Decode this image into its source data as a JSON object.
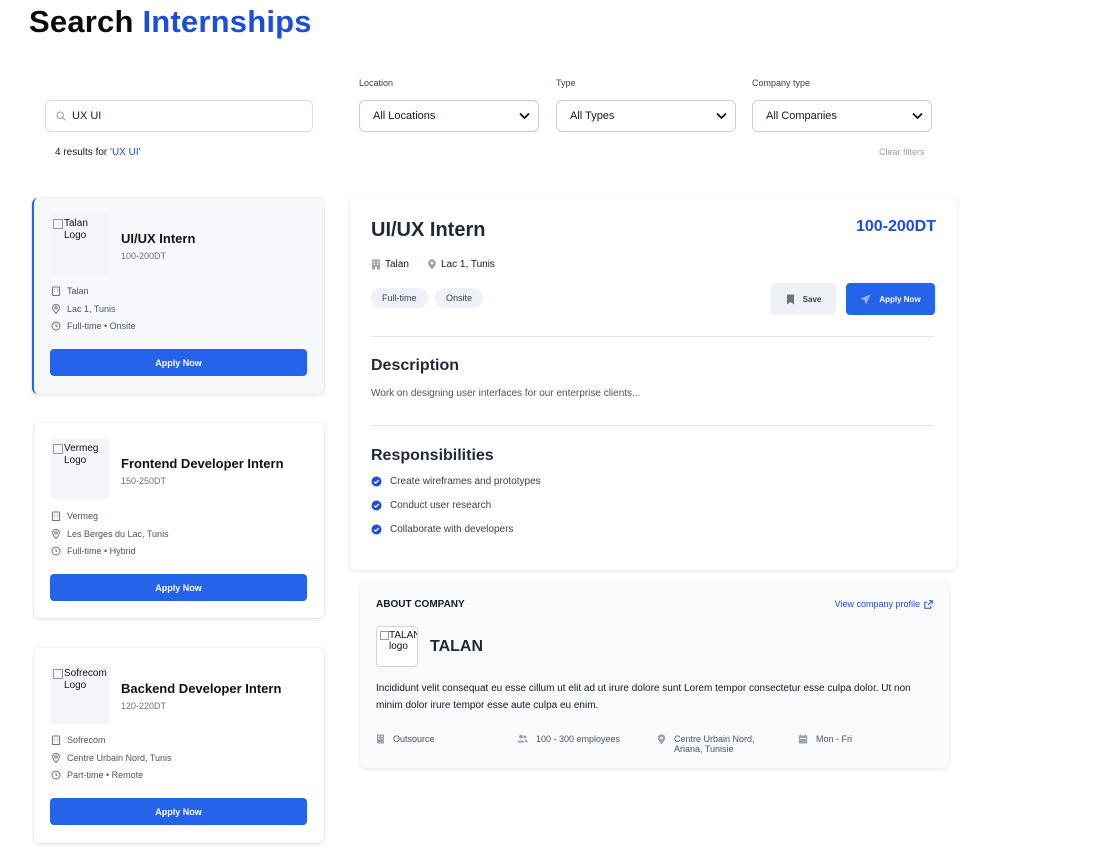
{
  "header": {
    "title_prefix": "Search",
    "title_accent": "Internships"
  },
  "filters": {
    "search_value": "UX UI",
    "location": {
      "label": "Location",
      "selected": "All Locations"
    },
    "type": {
      "label": "Type",
      "selected": "All Types"
    },
    "company_type": {
      "label": "Company type",
      "selected": "All Companies"
    },
    "results_text": "4 results for ",
    "results_query": "'UX UI'",
    "clear_label": "Clear filters"
  },
  "cards": [
    {
      "logo_alt": "Talan Logo",
      "title": "UI/UX Intern",
      "salary": "100-200DT",
      "company": "Talan",
      "location": "Lac 1, Tunis",
      "schedule": "Full-time • Onsite",
      "apply_label": "Apply Now"
    },
    {
      "logo_alt": "Vermeg Logo",
      "title": "Frontend Developer Intern",
      "salary": "150-250DT",
      "company": "Vermeg",
      "location": "Les Berges du Lac, Tunis",
      "schedule": "Full-time • Hybrid",
      "apply_label": "Apply Now"
    },
    {
      "logo_alt": "Sofrecom Logo",
      "title": "Backend Developer Intern",
      "salary": "120-220DT",
      "company": "Sofrecom",
      "location": "Centre Urbain Nord, Tunis",
      "schedule": "Part-time • Remote",
      "apply_label": "Apply Now"
    }
  ],
  "detail": {
    "title": "UI/UX Intern",
    "salary": "100-200DT",
    "company": "Talan",
    "location": "Lac 1, Tunis",
    "tags": [
      "Full-time",
      "Onsite"
    ],
    "save_label": "Save",
    "apply_label": "Apply Now",
    "description_title": "Description",
    "description": "Work on designing user interfaces for our enterprise clients...",
    "responsibilities_title": "Responsibilities",
    "responsibilities": [
      "Create wireframes and prototypes",
      "Conduct user research",
      "Collaborate with developers"
    ]
  },
  "about": {
    "heading": "ABOUT COMPANY",
    "profile_link": "View company profile",
    "logo_alt": "TALAN logo",
    "name": "TALAN",
    "text": "Incididunt velit consequat eu esse cillum ut elit ad ut irure dolore sunt Lorem tempor consectetur esse culpa dolor. Ut non minim dolor irure tempor esse aute culpa eu enim.",
    "facts": {
      "type": "Outsource",
      "employees": "100 - 300 employees",
      "address_line1": "Centre Urbain Nord,",
      "address_line2": "Ariana, Tunisie",
      "days": "Mon - Fri"
    }
  },
  "colors": {
    "accent": "#2563eb",
    "title_accent": "#1d4ed8"
  }
}
